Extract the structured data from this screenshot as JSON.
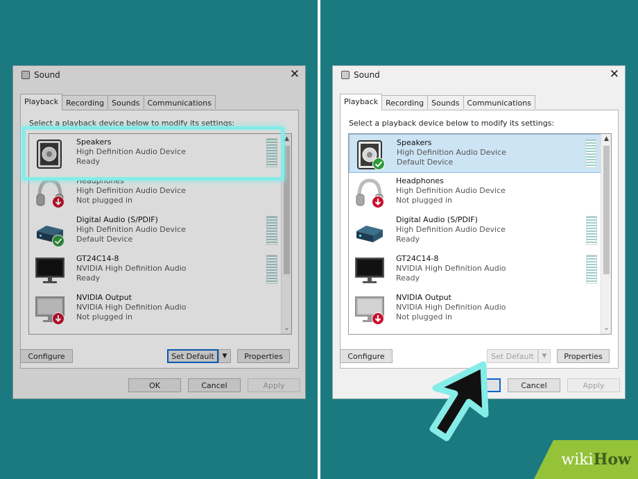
{
  "colors": {
    "background": "#1b7a80",
    "highlight": "#86ece8",
    "selection": "#cde4f5",
    "wikihow_green": "#94c33a"
  },
  "dialog_title": "Sound",
  "close_glyph": "✕",
  "tabs": [
    {
      "label": "Playback"
    },
    {
      "label": "Recording"
    },
    {
      "label": "Sounds"
    },
    {
      "label": "Communications"
    }
  ],
  "instruction": "Select a playback device below to modify its settings:",
  "scroll_up_glyph": "▲",
  "scroll_down_glyph": "⌄",
  "left": {
    "devices": [
      {
        "name": "Speakers",
        "desc": "High Definition Audio Device",
        "status": "Ready",
        "icon": "speaker-icon"
      },
      {
        "name": "Headphones",
        "desc": "High Definition Audio Device",
        "status": "Not plugged in",
        "icon": "headphones-icon"
      },
      {
        "name": "Digital Audio (S/PDIF)",
        "desc": "High Definition Audio Device",
        "status": "Default Device",
        "icon": "digital-audio-icon"
      },
      {
        "name": "GT24C14-8",
        "desc": "NVIDIA High Definition Audio",
        "status": "Ready",
        "icon": "monitor-icon"
      },
      {
        "name": "NVIDIA Output",
        "desc": "NVIDIA High Definition Audio",
        "status": "Not plugged in",
        "icon": "monitor-icon"
      }
    ]
  },
  "right": {
    "devices": [
      {
        "name": "Speakers",
        "desc": "High Definition Audio Device",
        "status": "Default Device",
        "icon": "speaker-icon"
      },
      {
        "name": "Headphones",
        "desc": "High Definition Audio Device",
        "status": "Not plugged in",
        "icon": "headphones-icon"
      },
      {
        "name": "Digital Audio (S/PDIF)",
        "desc": "High Definition Audio Device",
        "status": "Ready",
        "icon": "digital-audio-icon"
      },
      {
        "name": "GT24C14-8",
        "desc": "NVIDIA High Definition Audio",
        "status": "Ready",
        "icon": "monitor-icon"
      },
      {
        "name": "NVIDIA Output",
        "desc": "NVIDIA High Definition Audio",
        "status": "Not plugged in",
        "icon": "monitor-icon"
      }
    ]
  },
  "buttons": {
    "configure": "Configure",
    "set_default": "Set Default",
    "dropdown_glyph": "▼",
    "properties": "Properties",
    "ok": "OK",
    "cancel": "Cancel",
    "apply": "Apply"
  },
  "watermark": {
    "wiki": "wiki",
    "how": "How"
  }
}
